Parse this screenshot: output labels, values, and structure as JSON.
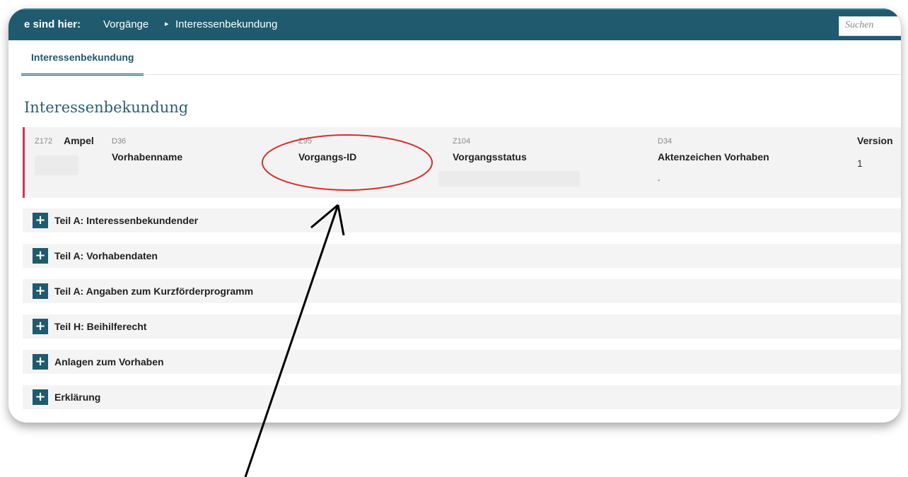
{
  "breadcrumb": {
    "label": "e sind hier:",
    "items": [
      "Vorgänge",
      "Interessenbekundung"
    ],
    "separator": "▸"
  },
  "search": {
    "placeholder": "Suchen"
  },
  "tab": {
    "label": "Interessenbekundung"
  },
  "page": {
    "title": "Interessenbekundung"
  },
  "info": {
    "ampel": {
      "code": "Z172",
      "label": "Ampel"
    },
    "vorhabenname": {
      "code": "D36",
      "label": "Vorhabenname"
    },
    "vorgangs_id": {
      "code": "Z95",
      "label": "Vorgangs-ID"
    },
    "vorgangsstatus": {
      "code": "Z104",
      "label": "Vorgangsstatus"
    },
    "aktenzeichen": {
      "code": "D34",
      "label": "Aktenzeichen Vorhaben",
      "value": "-"
    },
    "version": {
      "label": "Version",
      "value": "1"
    }
  },
  "sections": [
    {
      "label": "Teil A: Interessenbekundender"
    },
    {
      "label": "Teil A: Vorhabendaten"
    },
    {
      "label": "Teil A: Angaben zum Kurzförderprogramm"
    },
    {
      "label": "Teil H: Beihilferecht"
    },
    {
      "label": "Anlagen zum Vorhaben"
    },
    {
      "label": "Erklärung"
    }
  ],
  "plus_symbol": "+",
  "colors": {
    "header": "#1f5a6e",
    "accent": "#c8395d",
    "annotation_circle": "#d32f2f"
  },
  "icons": [
    "plus-icon",
    "breadcrumb-separator-icon"
  ]
}
